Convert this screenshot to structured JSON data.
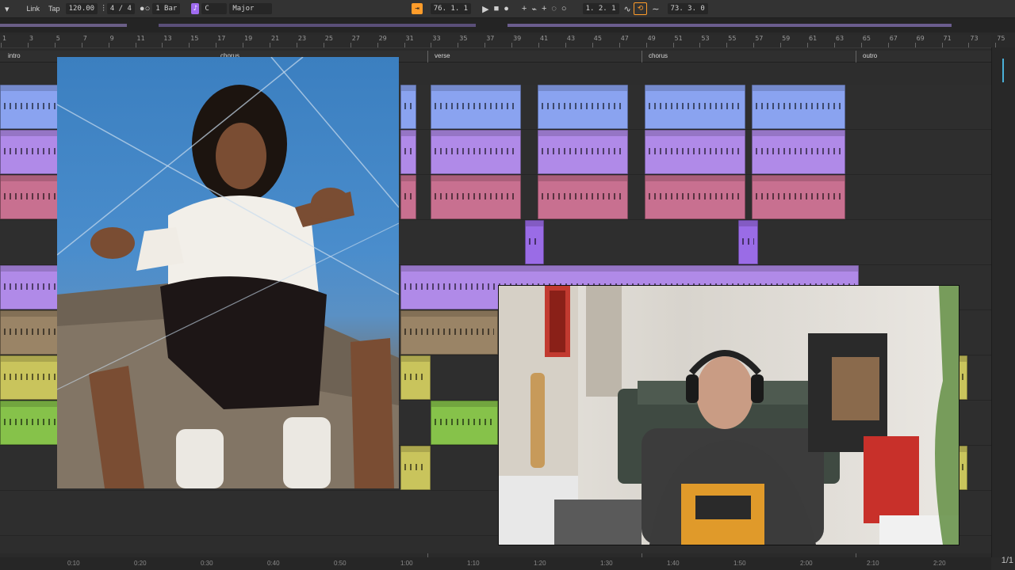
{
  "toolbar": {
    "link": "Link",
    "tap": "Tap",
    "tempo": "120.00",
    "meter": "4 / 4",
    "quantize": "1 Bar",
    "key_root": "C",
    "scale": "Major",
    "arrangement_position": "76.  1.  1",
    "loop_start": "1.  2.  1",
    "loop_length": "73.  3.  0"
  },
  "ruler": {
    "bars": [
      "1",
      "3",
      "5",
      "7",
      "9",
      "11",
      "13",
      "15",
      "17",
      "19",
      "21",
      "23",
      "25",
      "27",
      "29",
      "31",
      "33",
      "35",
      "37",
      "39",
      "41",
      "43",
      "45",
      "47",
      "49",
      "51",
      "53",
      "55",
      "57",
      "59",
      "61",
      "63",
      "65",
      "67",
      "69",
      "71",
      "73",
      "75"
    ]
  },
  "locators": [
    {
      "label": "intro"
    },
    {
      "label": "chorus"
    },
    {
      "label": "verse"
    },
    {
      "label": "chorus"
    },
    {
      "label": "outro"
    }
  ],
  "timeline": {
    "times": [
      "0:10",
      "0:20",
      "0:30",
      "0:40",
      "0:50",
      "1:00",
      "1:10",
      "1:20",
      "1:30",
      "1:40",
      "1:50",
      "2:00",
      "2:10",
      "2:20"
    ]
  },
  "page_indicator": "1/1",
  "colors": {
    "blue_clip": "#8aa3f0",
    "lavender_clip": "#b08ae8",
    "pink_clip": "#c87090",
    "violet_clip": "#9a6ce6",
    "tan_clip": "#9a8466",
    "olive_clip": "#c9c45c",
    "green_clip": "#86c24a",
    "accent_orange": "#ff9c2a"
  },
  "overlays": {
    "left_photo": "portrait-photo",
    "right_video": "webcam-video"
  }
}
